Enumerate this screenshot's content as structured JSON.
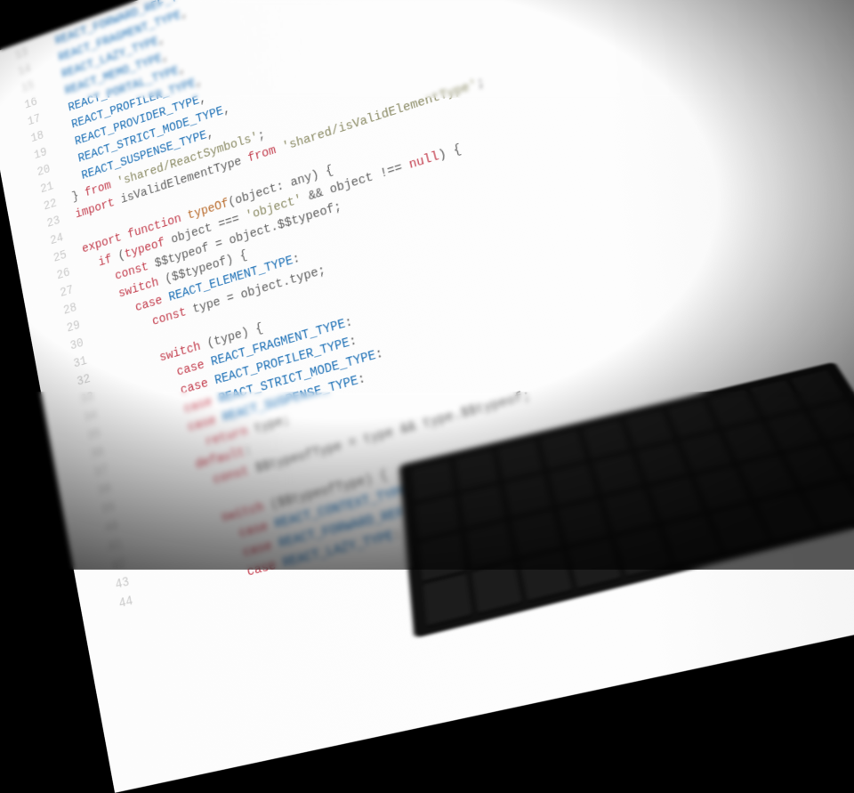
{
  "editor": {
    "language": "javascript",
    "first_line_number": 13,
    "lines": [
      {
        "n": 13,
        "tokens": [
          {
            "t": "  ",
            "c": ""
          },
          {
            "t": "REACT_FORWARD_REF_TYPE",
            "c": "c-type"
          },
          {
            "t": ",",
            "c": ""
          }
        ]
      },
      {
        "n": 14,
        "tokens": [
          {
            "t": "  ",
            "c": ""
          },
          {
            "t": "REACT_FRAGMENT_TYPE",
            "c": "c-type"
          },
          {
            "t": ",",
            "c": ""
          }
        ]
      },
      {
        "n": 15,
        "tokens": [
          {
            "t": "  ",
            "c": ""
          },
          {
            "t": "REACT_LAZY_TYPE",
            "c": "c-type"
          },
          {
            "t": ",",
            "c": ""
          }
        ]
      },
      {
        "n": 16,
        "tokens": [
          {
            "t": "  ",
            "c": ""
          },
          {
            "t": "REACT_MEMO_TYPE",
            "c": "c-type"
          },
          {
            "t": ",",
            "c": ""
          }
        ]
      },
      {
        "n": 17,
        "tokens": [
          {
            "t": "  ",
            "c": ""
          },
          {
            "t": "REACT_PORTAL_TYPE",
            "c": "c-type"
          },
          {
            "t": ",",
            "c": ""
          }
        ]
      },
      {
        "n": 18,
        "tokens": [
          {
            "t": "  ",
            "c": ""
          },
          {
            "t": "REACT_PROFILER_TYPE",
            "c": "c-type"
          },
          {
            "t": ",",
            "c": ""
          }
        ]
      },
      {
        "n": 19,
        "tokens": [
          {
            "t": "  ",
            "c": ""
          },
          {
            "t": "REACT_PROVIDER_TYPE",
            "c": "c-type"
          },
          {
            "t": ",",
            "c": ""
          }
        ]
      },
      {
        "n": 20,
        "tokens": [
          {
            "t": "  ",
            "c": ""
          },
          {
            "t": "REACT_STRICT_MODE_TYPE",
            "c": "c-type"
          },
          {
            "t": ",",
            "c": ""
          }
        ]
      },
      {
        "n": 21,
        "tokens": [
          {
            "t": "  ",
            "c": ""
          },
          {
            "t": "REACT_SUSPENSE_TYPE",
            "c": "c-type"
          },
          {
            "t": ",",
            "c": ""
          }
        ]
      },
      {
        "n": 22,
        "tokens": [
          {
            "t": "} ",
            "c": ""
          },
          {
            "t": "from",
            "c": "c-kw"
          },
          {
            "t": " ",
            "c": ""
          },
          {
            "t": "'shared/ReactSymbols'",
            "c": "c-str"
          },
          {
            "t": ";",
            "c": ""
          }
        ]
      },
      {
        "n": 23,
        "tokens": [
          {
            "t": "import",
            "c": "c-kw"
          },
          {
            "t": " isValidElementType ",
            "c": ""
          },
          {
            "t": "from",
            "c": "c-kw"
          },
          {
            "t": " ",
            "c": ""
          },
          {
            "t": "'shared/isValidElementType'",
            "c": "c-str"
          },
          {
            "t": ";",
            "c": ""
          }
        ]
      },
      {
        "n": 24,
        "tokens": [
          {
            "t": "",
            "c": ""
          }
        ]
      },
      {
        "n": 25,
        "tokens": [
          {
            "t": "export",
            "c": "c-kw"
          },
          {
            "t": " ",
            "c": ""
          },
          {
            "t": "function",
            "c": "c-kw"
          },
          {
            "t": " ",
            "c": ""
          },
          {
            "t": "typeOf",
            "c": "c-func"
          },
          {
            "t": "(object: any) {",
            "c": ""
          }
        ]
      },
      {
        "n": 26,
        "tokens": [
          {
            "t": "  ",
            "c": ""
          },
          {
            "t": "if",
            "c": "c-kw"
          },
          {
            "t": " (",
            "c": ""
          },
          {
            "t": "typeof",
            "c": "c-kw"
          },
          {
            "t": " object === ",
            "c": ""
          },
          {
            "t": "'object'",
            "c": "c-str"
          },
          {
            "t": " && object !== ",
            "c": ""
          },
          {
            "t": "null",
            "c": "c-kw"
          },
          {
            "t": ") {",
            "c": ""
          }
        ]
      },
      {
        "n": 27,
        "tokens": [
          {
            "t": "    ",
            "c": ""
          },
          {
            "t": "const",
            "c": "c-kw"
          },
          {
            "t": " $$typeof = object.$$typeof;",
            "c": ""
          }
        ]
      },
      {
        "n": 28,
        "tokens": [
          {
            "t": "    ",
            "c": ""
          },
          {
            "t": "switch",
            "c": "c-kw"
          },
          {
            "t": " ($$typeof) {",
            "c": ""
          }
        ]
      },
      {
        "n": 29,
        "tokens": [
          {
            "t": "      ",
            "c": ""
          },
          {
            "t": "case",
            "c": "c-kw"
          },
          {
            "t": " ",
            "c": ""
          },
          {
            "t": "REACT_ELEMENT_TYPE",
            "c": "c-type"
          },
          {
            "t": ":",
            "c": ""
          }
        ]
      },
      {
        "n": 30,
        "tokens": [
          {
            "t": "        ",
            "c": ""
          },
          {
            "t": "const",
            "c": "c-kw"
          },
          {
            "t": " type = object.type;",
            "c": ""
          }
        ]
      },
      {
        "n": 31,
        "tokens": [
          {
            "t": "",
            "c": ""
          }
        ]
      },
      {
        "n": 32,
        "tokens": [
          {
            "t": "        ",
            "c": ""
          },
          {
            "t": "switch",
            "c": "c-kw"
          },
          {
            "t": " (type) {",
            "c": ""
          }
        ]
      },
      {
        "n": 33,
        "tokens": [
          {
            "t": "          ",
            "c": ""
          },
          {
            "t": "case",
            "c": "c-kw"
          },
          {
            "t": " ",
            "c": ""
          },
          {
            "t": "REACT_FRAGMENT_TYPE",
            "c": "c-type"
          },
          {
            "t": ":",
            "c": ""
          }
        ]
      },
      {
        "n": 34,
        "tokens": [
          {
            "t": "          ",
            "c": ""
          },
          {
            "t": "case",
            "c": "c-kw"
          },
          {
            "t": " ",
            "c": ""
          },
          {
            "t": "REACT_PROFILER_TYPE",
            "c": "c-type"
          },
          {
            "t": ":",
            "c": ""
          }
        ]
      },
      {
        "n": 35,
        "tokens": [
          {
            "t": "          ",
            "c": ""
          },
          {
            "t": "case",
            "c": "c-kw"
          },
          {
            "t": " ",
            "c": ""
          },
          {
            "t": "REACT_STRICT_MODE_TYPE",
            "c": "c-type"
          },
          {
            "t": ":",
            "c": ""
          }
        ]
      },
      {
        "n": 36,
        "tokens": [
          {
            "t": "          ",
            "c": ""
          },
          {
            "t": "case",
            "c": "c-kw"
          },
          {
            "t": " ",
            "c": ""
          },
          {
            "t": "REACT_SUSPENSE_TYPE",
            "c": "c-type"
          },
          {
            "t": ":",
            "c": ""
          }
        ]
      },
      {
        "n": 37,
        "tokens": [
          {
            "t": "            ",
            "c": ""
          },
          {
            "t": "return",
            "c": "c-kw"
          },
          {
            "t": " type;",
            "c": ""
          }
        ]
      },
      {
        "n": 38,
        "tokens": [
          {
            "t": "          ",
            "c": ""
          },
          {
            "t": "default",
            "c": "c-kw"
          },
          {
            "t": ":",
            "c": ""
          }
        ]
      },
      {
        "n": 39,
        "tokens": [
          {
            "t": "            ",
            "c": ""
          },
          {
            "t": "const",
            "c": "c-kw"
          },
          {
            "t": " $$typeofType = type && type.$$typeof;",
            "c": ""
          }
        ]
      },
      {
        "n": 40,
        "tokens": [
          {
            "t": "",
            "c": ""
          }
        ]
      },
      {
        "n": 41,
        "tokens": [
          {
            "t": "            ",
            "c": ""
          },
          {
            "t": "switch",
            "c": "c-kw"
          },
          {
            "t": " ($$typeofType) {",
            "c": ""
          }
        ]
      },
      {
        "n": 42,
        "tokens": [
          {
            "t": "              ",
            "c": ""
          },
          {
            "t": "case",
            "c": "c-kw"
          },
          {
            "t": " ",
            "c": ""
          },
          {
            "t": "REACT_CONTEXT_TYPE",
            "c": "c-type"
          },
          {
            "t": ":",
            "c": ""
          }
        ]
      },
      {
        "n": 43,
        "tokens": [
          {
            "t": "              ",
            "c": ""
          },
          {
            "t": "case",
            "c": "c-kw"
          },
          {
            "t": " ",
            "c": ""
          },
          {
            "t": "REACT_FORWARD_REF_TYPE",
            "c": "c-type"
          },
          {
            "t": ":",
            "c": ""
          }
        ]
      },
      {
        "n": 44,
        "tokens": [
          {
            "t": "              ",
            "c": ""
          },
          {
            "t": "case",
            "c": "c-kw"
          },
          {
            "t": " ",
            "c": ""
          },
          {
            "t": "REACT_LAZY_TYPE",
            "c": "c-type"
          },
          {
            "t": ":",
            "c": ""
          }
        ]
      }
    ]
  }
}
